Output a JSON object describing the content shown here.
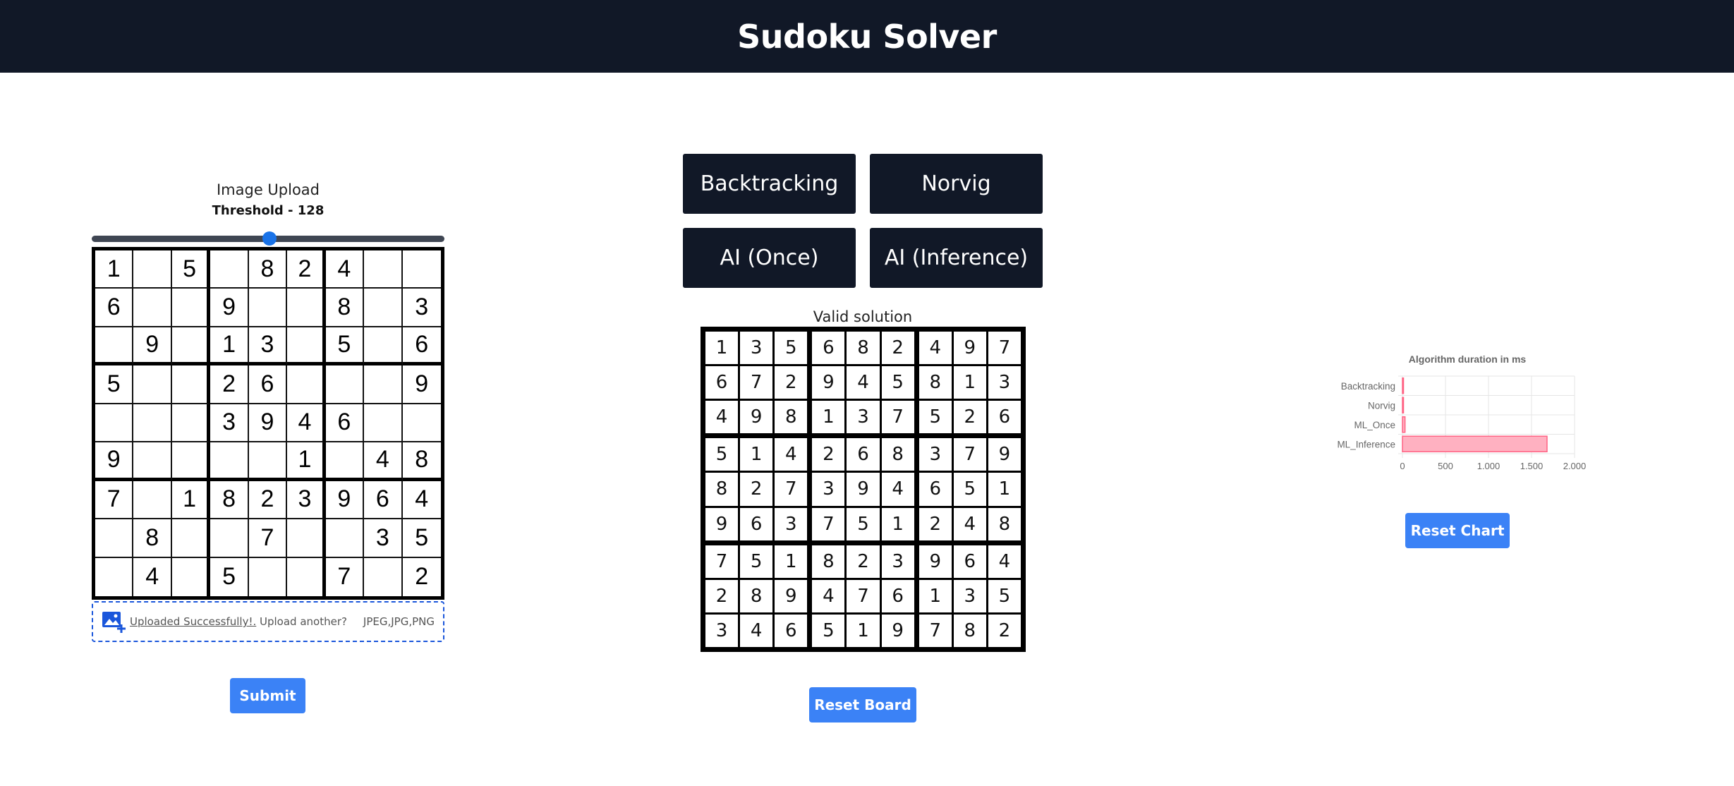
{
  "app": {
    "title": "Sudoku Solver"
  },
  "upload": {
    "label": "Image Upload",
    "threshold_label": "Threshold - 128",
    "threshold_value": 128,
    "status_text": "Uploaded Successfully!.",
    "upload_another": " Upload another?",
    "file_types": "JPEG,JPG,PNG",
    "submit_label": "Submit",
    "puzzle": [
      [
        "1",
        "",
        "5",
        "",
        "8",
        "2",
        "4",
        "",
        ""
      ],
      [
        "6",
        "",
        "",
        "9",
        "",
        "",
        "8",
        "",
        "3"
      ],
      [
        "",
        "9",
        "",
        "1",
        "3",
        "",
        "5",
        "",
        "6"
      ],
      [
        "5",
        "",
        "",
        "2",
        "6",
        "",
        "",
        "",
        "9"
      ],
      [
        "",
        "",
        "",
        "3",
        "9",
        "4",
        "6",
        "",
        ""
      ],
      [
        "9",
        "",
        "",
        "",
        "",
        "1",
        "",
        "4",
        "8"
      ],
      [
        "7",
        "",
        "1",
        "8",
        "2",
        "3",
        "9",
        "6",
        "4"
      ],
      [
        "",
        "8",
        "",
        "",
        "7",
        "",
        "",
        "3",
        "5"
      ],
      [
        "",
        "4",
        "",
        "5",
        "",
        "",
        "7",
        "",
        "2"
      ]
    ]
  },
  "solver": {
    "buttons": [
      "Backtracking",
      "Norvig",
      "AI (Once)",
      "AI (Inference)"
    ],
    "status": "Valid solution",
    "reset_label": "Reset Board",
    "solution": [
      [
        "1",
        "3",
        "5",
        "6",
        "8",
        "2",
        "4",
        "9",
        "7"
      ],
      [
        "6",
        "7",
        "2",
        "9",
        "4",
        "5",
        "8",
        "1",
        "3"
      ],
      [
        "4",
        "9",
        "8",
        "1",
        "3",
        "7",
        "5",
        "2",
        "6"
      ],
      [
        "5",
        "1",
        "4",
        "2",
        "6",
        "8",
        "3",
        "7",
        "9"
      ],
      [
        "8",
        "2",
        "7",
        "3",
        "9",
        "4",
        "6",
        "5",
        "1"
      ],
      [
        "9",
        "6",
        "3",
        "7",
        "5",
        "1",
        "2",
        "4",
        "8"
      ],
      [
        "7",
        "5",
        "1",
        "8",
        "2",
        "3",
        "9",
        "6",
        "4"
      ],
      [
        "2",
        "8",
        "9",
        "4",
        "7",
        "6",
        "1",
        "3",
        "5"
      ],
      [
        "3",
        "4",
        "6",
        "5",
        "1",
        "9",
        "7",
        "8",
        "2"
      ]
    ]
  },
  "chart": {
    "reset_label": "Reset Chart"
  },
  "chart_data": {
    "type": "bar",
    "orientation": "horizontal",
    "title": "Algorithm duration in ms",
    "categories": [
      "Backtracking",
      "Norvig",
      "ML_Once",
      "ML_Inference"
    ],
    "values": [
      3,
      2,
      30,
      1680
    ],
    "xlim": [
      0,
      2000
    ],
    "xticks": [
      "0",
      "500",
      "1.000",
      "1.500",
      "2.000"
    ],
    "grid": true,
    "bar_color": "#ffb1c1",
    "bar_border_color": "#ff6384"
  }
}
